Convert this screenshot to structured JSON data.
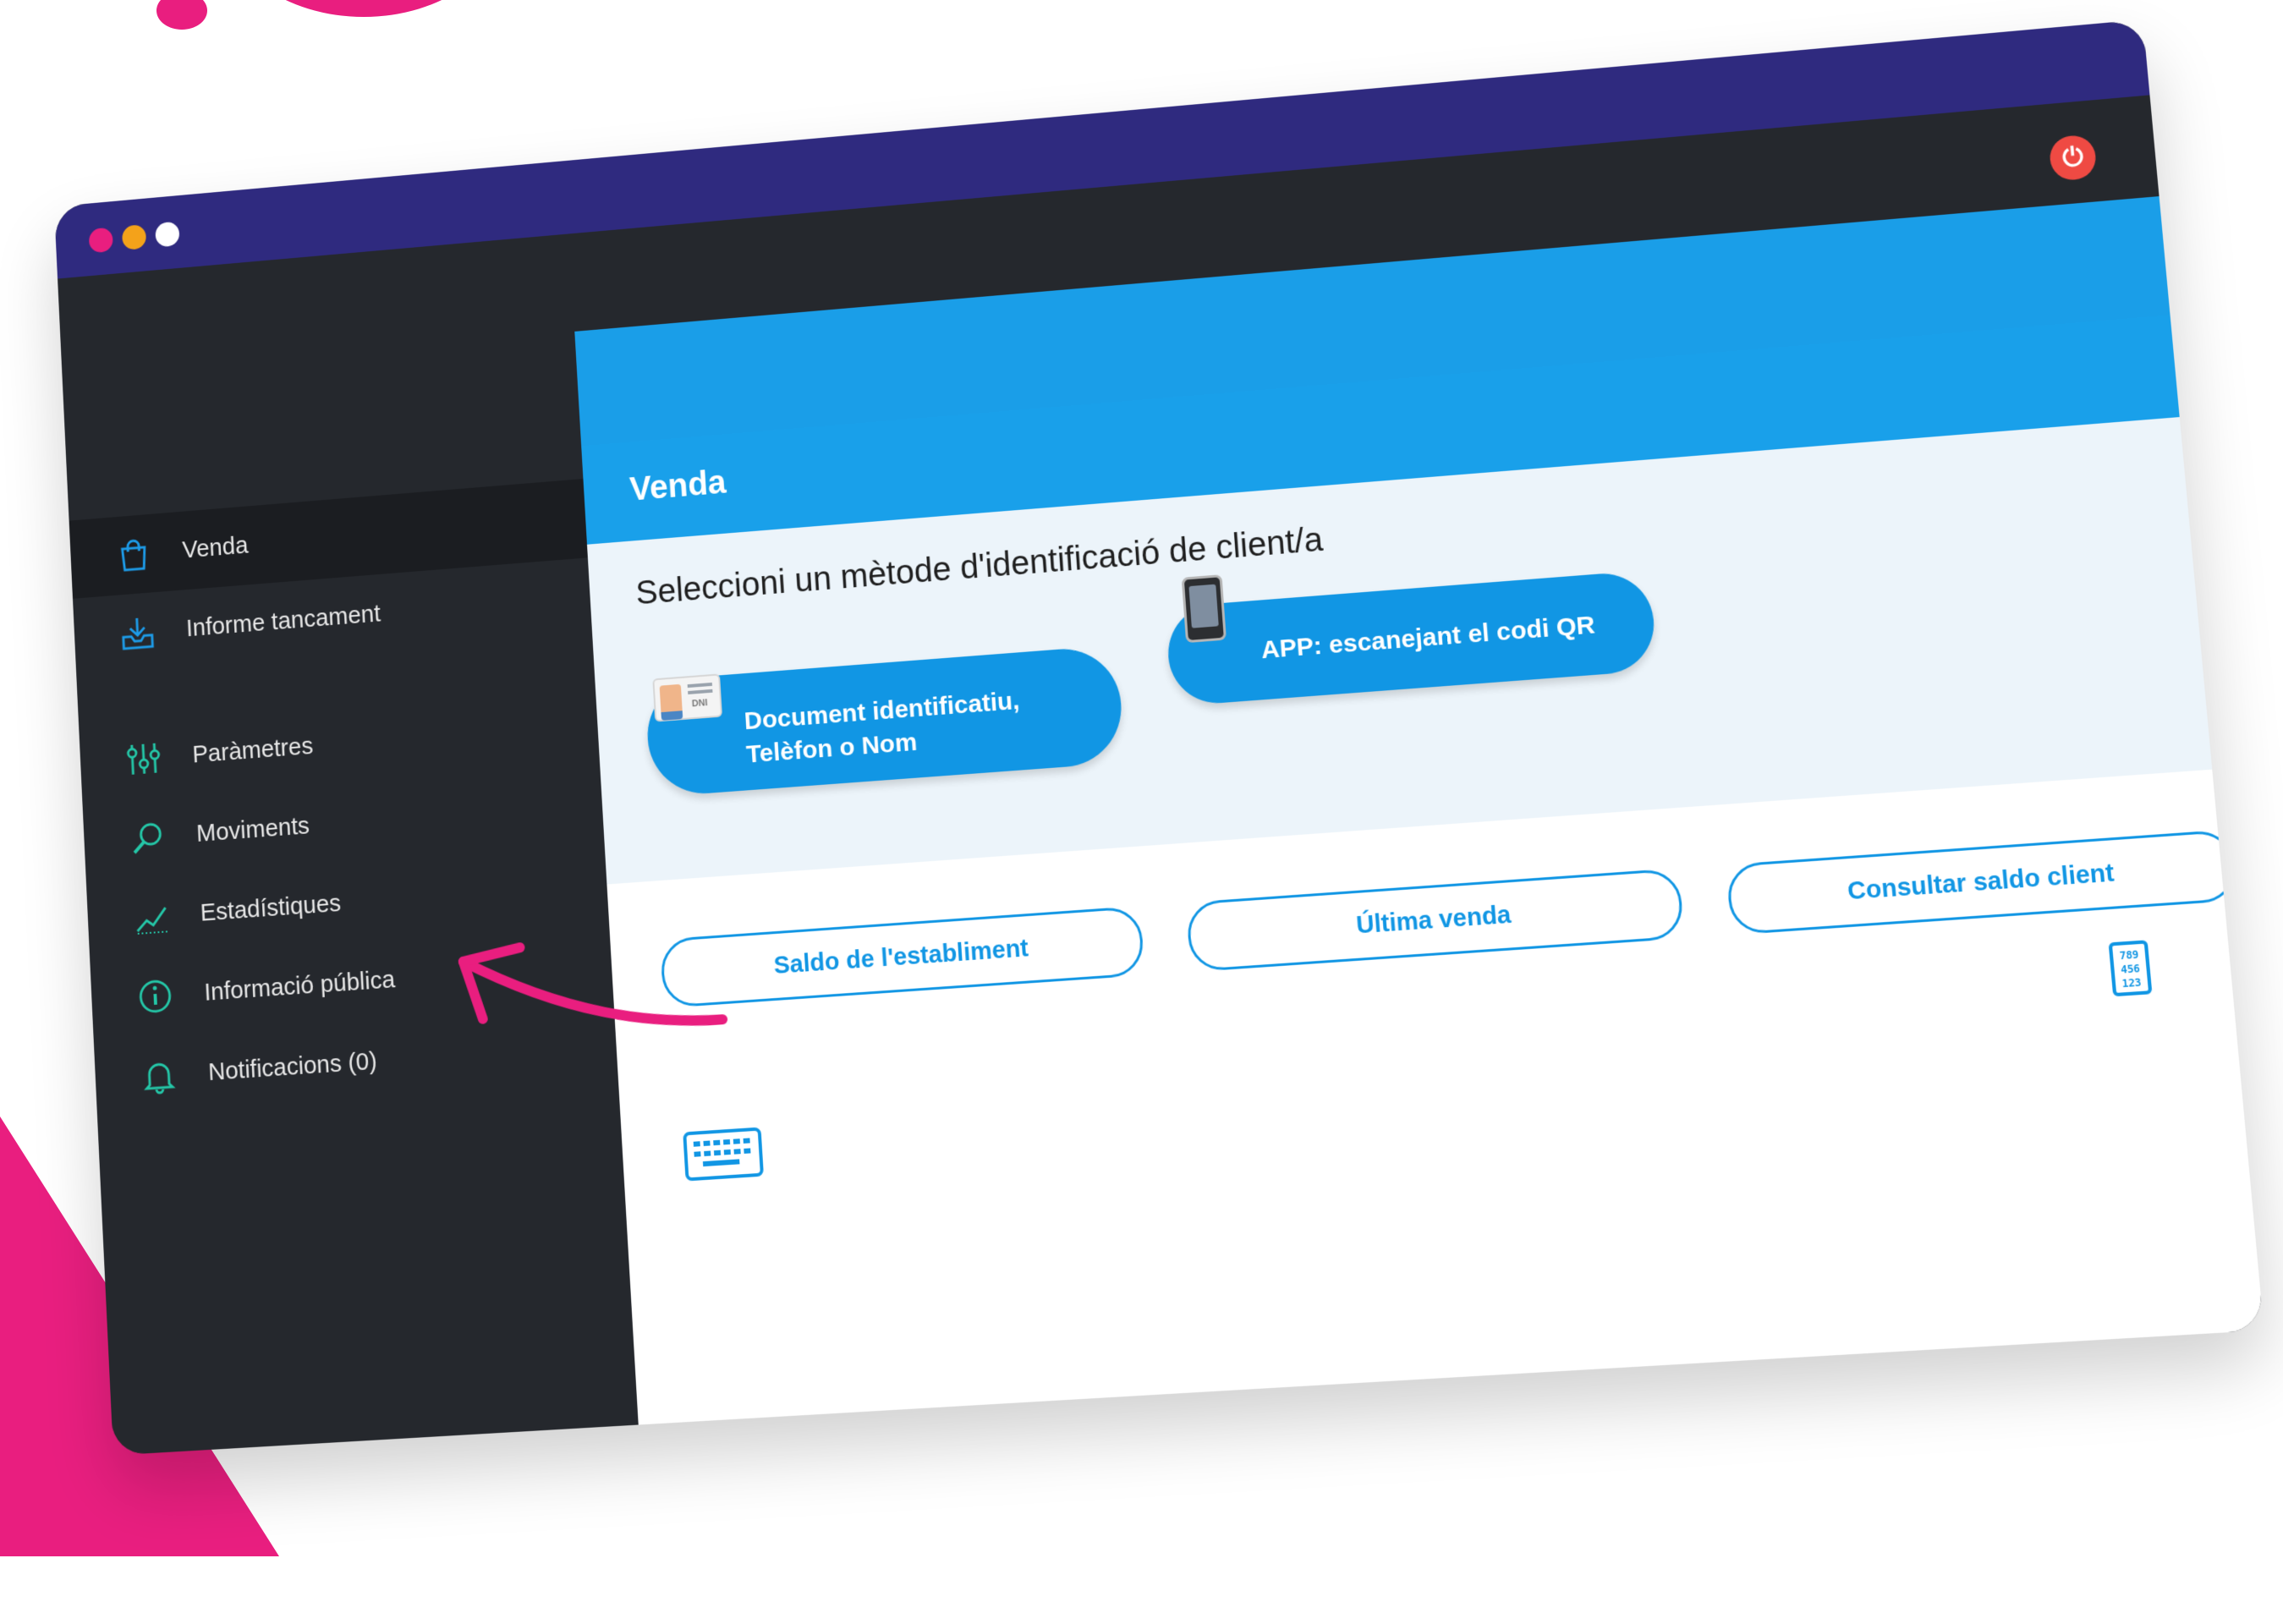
{
  "window": {
    "logout_icon": "logout-icon",
    "controls": [
      "close-dot",
      "minimize-dot",
      "maximize-dot"
    ]
  },
  "sidebar": {
    "items": [
      {
        "label": "Venda",
        "icon": "shopping-bag-icon",
        "active": true
      },
      {
        "label": "Informe tancament",
        "icon": "download-tray-icon"
      },
      {
        "label": "Paràmetres",
        "icon": "sliders-icon"
      },
      {
        "label": "Moviments",
        "icon": "magnifier-icon"
      },
      {
        "label": "Estadístiques",
        "icon": "chart-line-icon"
      },
      {
        "label": "Informació pública",
        "icon": "info-icon"
      },
      {
        "label": "Notificacions (0)",
        "icon": "bell-icon"
      }
    ]
  },
  "panel": {
    "title": "Venda",
    "prompt": "Seleccioni un mètode d'identificació de client/a",
    "methods": [
      {
        "label_line1": "Document identificatiu,",
        "label_line2": "Telèfon o Nom",
        "icon": "id-card-icon",
        "card_text": "DNI"
      },
      {
        "label": "APP: escanejant el codi QR",
        "icon": "phone-icon"
      }
    ]
  },
  "actions": {
    "balance": "Saldo de l'establiment",
    "last_sale": "Última venda",
    "client_balance": "Consultar saldo client"
  },
  "numpad": {
    "row1": "789",
    "row2": "456",
    "row3": "123"
  },
  "colors": {
    "accent": "#1196e4",
    "titlebar": "#2f2a7f",
    "sidebar": "#25282d",
    "highlight": "#e91e7f",
    "sidebar_icon": "#24c6a7"
  }
}
